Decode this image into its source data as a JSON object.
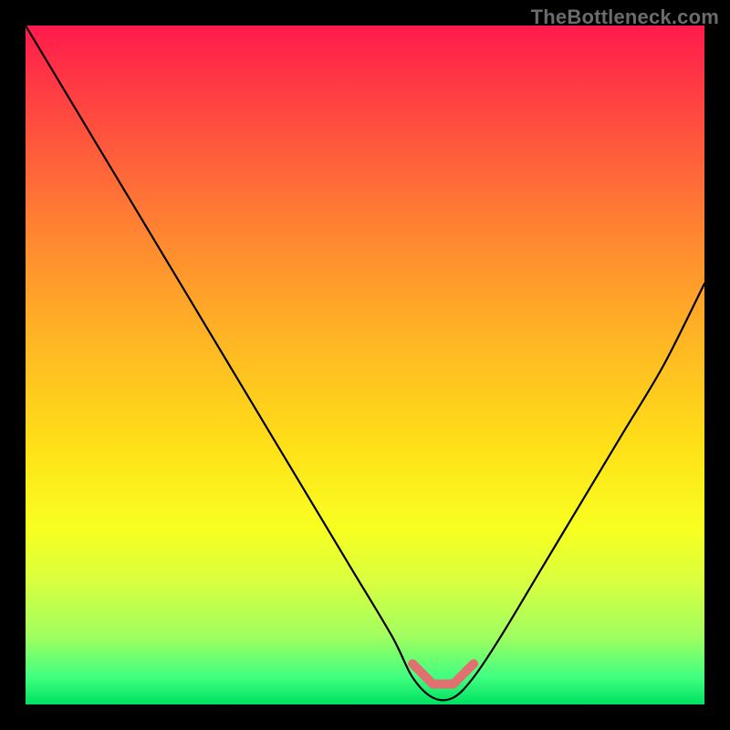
{
  "watermark": "TheBottleneck.com",
  "chart_data": {
    "type": "line",
    "title": "",
    "xlabel": "",
    "ylabel": "",
    "xlim": [
      0,
      100
    ],
    "ylim": [
      0,
      100
    ],
    "series": [
      {
        "name": "bottleneck-curve",
        "x": [
          0,
          6,
          12,
          18,
          24,
          30,
          36,
          42,
          48,
          54,
          57,
          60,
          63,
          66,
          70,
          76,
          82,
          88,
          94,
          100
        ],
        "values": [
          100,
          90,
          80,
          70,
          60,
          50,
          40,
          30,
          20,
          10,
          4,
          1,
          1,
          4,
          10,
          20,
          30,
          40,
          50,
          62
        ]
      }
    ],
    "annotations": [
      {
        "name": "minimum-marker",
        "x_start": 55,
        "x_end": 66,
        "y": 2
      }
    ],
    "gradient_stops": [
      {
        "pos": 0,
        "color": "#ff1a4e"
      },
      {
        "pos": 18,
        "color": "#ff5a3c"
      },
      {
        "pos": 46,
        "color": "#ffb524"
      },
      {
        "pos": 74,
        "color": "#f8ff20"
      },
      {
        "pos": 100,
        "color": "#00e060"
      }
    ]
  }
}
